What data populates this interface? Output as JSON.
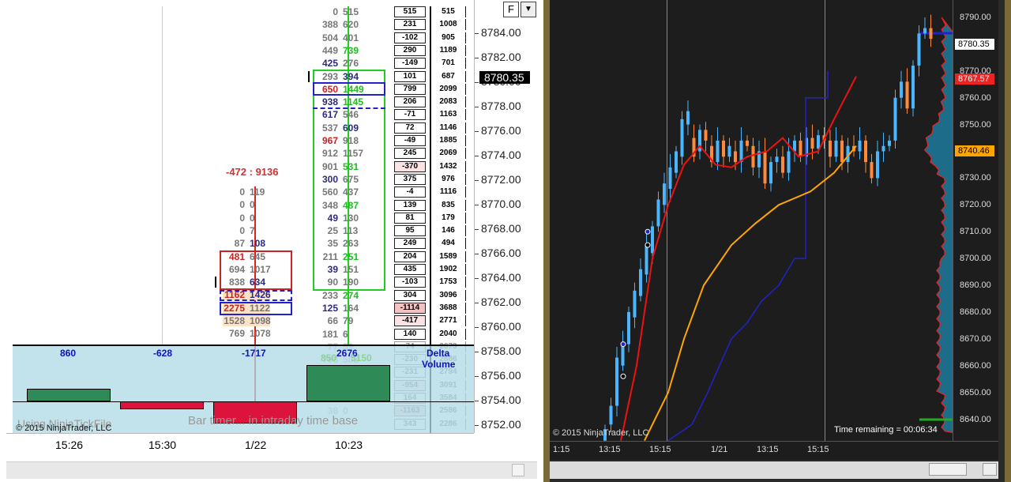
{
  "left_chart": {
    "fp_top": [
      [
        "0",
        "515"
      ],
      [
        "388",
        "620"
      ],
      [
        "504",
        "401"
      ],
      [
        "449",
        "739"
      ],
      [
        "425",
        "276"
      ],
      [
        "293",
        "394"
      ],
      [
        "650",
        "1449"
      ],
      [
        "938",
        "1145"
      ],
      [
        "617",
        "546"
      ],
      [
        "537",
        "609"
      ],
      [
        "967",
        "918"
      ],
      [
        "912",
        "1157"
      ],
      [
        "901",
        "531"
      ],
      [
        "300",
        "675"
      ],
      [
        "560",
        "437"
      ],
      [
        "348",
        "487"
      ],
      [
        "49",
        "130"
      ],
      [
        "25",
        "113"
      ],
      [
        "35",
        "263"
      ],
      [
        "211",
        "251"
      ],
      [
        "39",
        "151"
      ],
      [
        "90",
        "190"
      ],
      [
        "233",
        "274"
      ],
      [
        "125",
        "164"
      ],
      [
        "66",
        "79"
      ],
      [
        "181",
        "6"
      ],
      [
        "77",
        "59"
      ],
      [
        "798",
        "502"
      ],
      [
        "926",
        "375"
      ],
      [
        "381",
        "438"
      ],
      [
        "120",
        "93"
      ],
      [
        "38",
        "0"
      ]
    ],
    "fp_bar2": [
      [
        "0",
        "119"
      ],
      [
        "0",
        "0"
      ],
      [
        "0",
        "0"
      ],
      [
        "0",
        "7"
      ],
      [
        "87",
        "108"
      ],
      [
        "481",
        "645"
      ],
      [
        "694",
        "1017"
      ],
      [
        "838",
        "634"
      ],
      [
        "1162",
        "1426"
      ],
      [
        "2275",
        "1122"
      ],
      [
        "1528",
        "1098"
      ],
      [
        "769",
        "1078"
      ]
    ],
    "bar2_header": "-472 : 9136",
    "delta_col": [
      "515",
      "231",
      "-102",
      "290",
      "-149",
      "101",
      "799",
      "206",
      "-71",
      "72",
      "-49",
      "245",
      "-370",
      "375",
      "-4",
      "139",
      "81",
      "95",
      "249",
      "204",
      "435",
      "-103",
      "304",
      "-1114",
      "-417",
      "140",
      "74",
      "-230",
      "-231",
      "-954",
      "164",
      "-1163",
      "343"
    ],
    "volume_col": [
      "515",
      "1008",
      "905",
      "1189",
      "701",
      "687",
      "2099",
      "2083",
      "1163",
      "1146",
      "1885",
      "2069",
      "1432",
      "976",
      "1116",
      "835",
      "179",
      "146",
      "494",
      "1589",
      "1902",
      "1753",
      "3096",
      "3688",
      "2771",
      "2040",
      "2673",
      "2886",
      "2794",
      "3091",
      "3584",
      "2586",
      "2286"
    ],
    "price_axis": [
      "8784.00",
      "8782.00",
      "8780.00",
      "8778.00",
      "8776.00",
      "8774.00",
      "8772.00",
      "8770.00",
      "8768.00",
      "8766.00",
      "8764.00",
      "8762.00",
      "8760.00",
      "8758.00",
      "8756.00",
      "8754.00",
      "8752.00"
    ],
    "last_price": "8780.35",
    "delta_panel_values": [
      "860",
      "-628",
      "-1717",
      "2676"
    ],
    "delta_panel_labels": [
      "Delta",
      "Volume"
    ],
    "delta_overlay": [
      "850",
      "5150"
    ],
    "x_labels": [
      "15:26",
      "15:30",
      "1/22",
      "10:23"
    ],
    "watermark1": "Using NinjaTickFile",
    "watermark2": "Bar timer... in intraday time base",
    "copyright": "© 2015 NinjaTrader, LLC",
    "button_f": "F",
    "button_dropdown": "▼"
  },
  "right_chart": {
    "price_axis": [
      "8790.00",
      "8780.00",
      "8770.00",
      "8760.00",
      "8750.00",
      "8740.00",
      "8730.00",
      "8720.00",
      "8710.00",
      "8700.00",
      "8690.00",
      "8680.00",
      "8670.00",
      "8660.00",
      "8650.00",
      "8640.00"
    ],
    "marker_current": "8780.35",
    "marker_red": "8767.57",
    "marker_orange": "8740.46",
    "x_labels": [
      "1:15",
      "13:15",
      "15:15",
      "1/21",
      "13:15",
      "15:15"
    ],
    "copyright": "© 2015 NinjaTrader, LLC",
    "time_remaining": "Time remaining = 00:06:34"
  },
  "colors": {
    "sell": "#2a2a7e",
    "buy": "#22bb22",
    "red": "#cc2222",
    "candle_up": "#49b6ff",
    "candle_down": "#ff8a3c",
    "ema_fast": "#ee1111",
    "ema_slow": "#ffa500",
    "step_line": "#2222cc"
  }
}
